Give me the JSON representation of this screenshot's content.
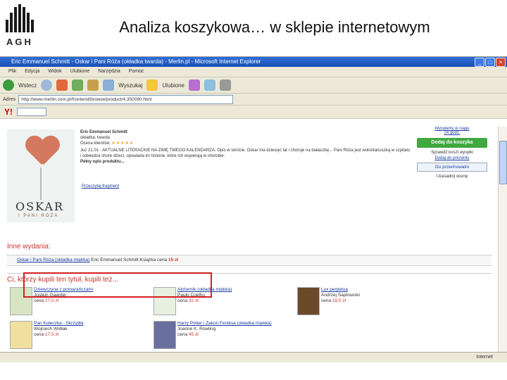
{
  "slide": {
    "title": "Analiza koszykowa… w sklepie internetowym",
    "logo_text": "AGH"
  },
  "window": {
    "title": "Eric Emmanuel Schmitt - Oskar i Pani Róża (okładka twarda) - Merlin.pl - Microsoft Internet Explorer"
  },
  "menubar": [
    "Plik",
    "Edycja",
    "Widok",
    "Ulubione",
    "Narzędzia",
    "Pomoc"
  ],
  "toolbar": {
    "back_label": "Wstecz",
    "search_label": "Wyszukaj",
    "favorites_label": "Ulubione"
  },
  "address": {
    "label": "Adres",
    "url": "http://www.merlin.com.pl/frontend/browse/product/4,350090.html"
  },
  "yahoobar": {
    "logo": "Y!"
  },
  "product": {
    "cover_title": "OSKAR",
    "cover_subtitle": "I PANI RÓŻA",
    "author": "Eric Emmanuel Schmitt",
    "binding": "okładka: twarda",
    "rating_label": "Ocena klientów:",
    "rating_stars": "★★★★★",
    "description": "Już 21.01 - AKTUALNE LITERACKIE NA ZIMĘ TWEGO KALENDARZA. Opis w skrócie. Oskar ma dziesięć lat i choruje na białaczkę... Pani Róża jest wolontariuszką w szpitalu i odwiedza chore dzieci, opowiada im historie, które ich wspierają w chorobie.",
    "full_description": "Pełny opis produktu...",
    "fragment_link": "Przeczytaj fragment"
  },
  "sidebar": {
    "shipping_link": "Wysyłamy w ciągu",
    "shipping_time": "24 godz.",
    "add_to_cart": "Dodaj do koszyka",
    "free_shipping": "Sprawdź koszt wysyłki",
    "gift_link": "Dodaj do prezentu",
    "hold_button": "Do przechowalni",
    "extra_link": "Uzasadnij ocenę"
  },
  "other_editions": {
    "heading": "Inne wydania:",
    "item_title": "Oskar i Pani Róża (okładka miękka)",
    "item_author": "Eric Emmanuel Schmitt",
    "item_type": "Książka",
    "item_price_label": "cena",
    "item_price": "15 zł"
  },
  "also_bought": {
    "heading": "Ci, którzy kupili ten tytuł, kupili też...",
    "items": [
      {
        "title": "Dziewczyna z pomarańczami",
        "author": "Jostein Gaarder",
        "price_label": "cena",
        "price": "27,5 zł"
      },
      {
        "title": "Alchemik (okładka miękka)",
        "author": "Paulo Coelho",
        "price_label": "cena",
        "price": "32 zł"
      },
      {
        "title": "Lux perpetua",
        "author": "Andrzej Sapkowski",
        "price_label": "cena",
        "price": "18,5 zł"
      },
      {
        "title": "Pan Kuleczka - Skrzydła",
        "author": "Wojciech Widłak",
        "price_label": "cena",
        "price": "17,5 zł"
      },
      {
        "title": "Harry Potter i Zakon Feniksa (okładka miękka)",
        "author": "Joanne K. Rowling",
        "price_label": "cena",
        "price": "45 zł"
      }
    ]
  },
  "status": {
    "left": "",
    "zone": "Internet"
  },
  "colors": {
    "accent_red": "#c8332a",
    "link_blue": "#1a3aa0",
    "cart_green": "#3fa83f",
    "highlight_box": "#d32020"
  }
}
